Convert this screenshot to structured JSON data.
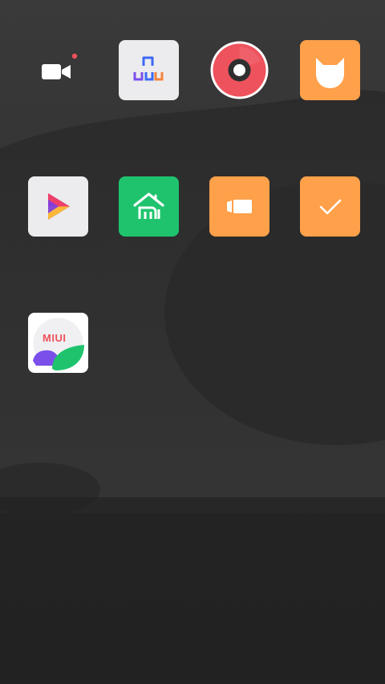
{
  "colors": {
    "orange": "#FFA04A",
    "green": "#1FC36E",
    "red": "#EE525C",
    "white_tile": "#ECECEE",
    "wallpaper_top": "#3a3a3a",
    "wallpaper_bottom": "#222222"
  },
  "apps": [
    {
      "icon": "video-camera-icon"
    },
    {
      "icon": "app-vault-icon"
    },
    {
      "icon": "music-disc-icon"
    },
    {
      "icon": "cat-face-icon"
    },
    {
      "icon": "play-store-icon"
    },
    {
      "icon": "mi-home-icon"
    },
    {
      "icon": "screen-recorder-icon"
    },
    {
      "icon": "tasks-check-icon"
    },
    {
      "icon": "miui-logo-icon",
      "label": "MIUI"
    }
  ]
}
